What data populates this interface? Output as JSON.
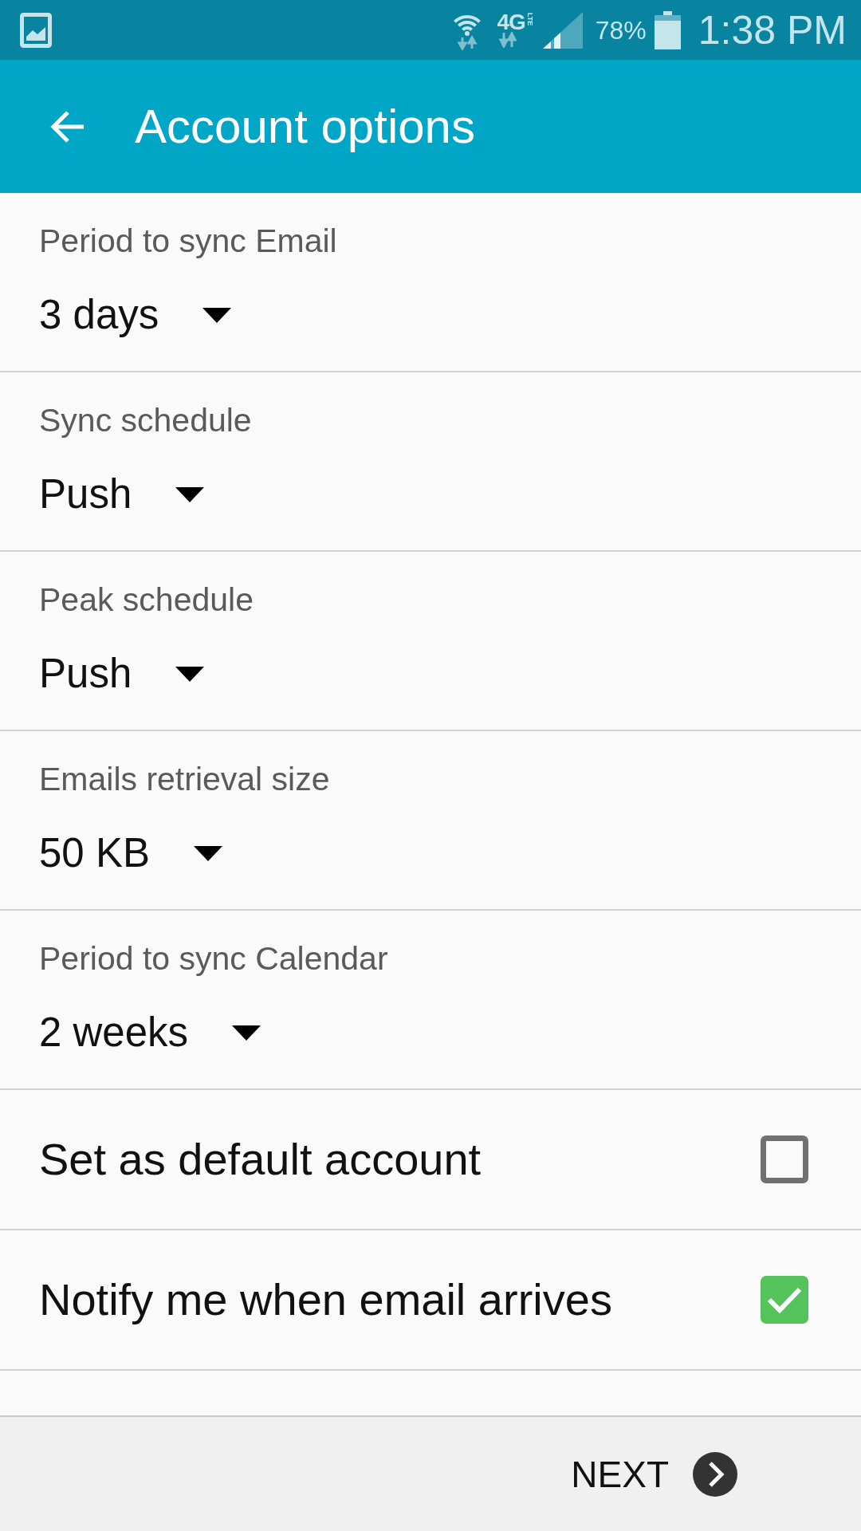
{
  "status_bar": {
    "network": "4G",
    "network_sub": "LTE",
    "battery": "78%",
    "time": "1:38 PM"
  },
  "app_bar": {
    "title": "Account options"
  },
  "settings": [
    {
      "kind": "dropdown",
      "label": "Period to sync Email",
      "value": "3 days"
    },
    {
      "kind": "dropdown",
      "label": "Sync schedule",
      "value": "Push"
    },
    {
      "kind": "dropdown",
      "label": "Peak schedule",
      "value": "Push"
    },
    {
      "kind": "dropdown",
      "label": "Emails retrieval size",
      "value": "50 KB"
    },
    {
      "kind": "dropdown",
      "label": "Period to sync Calendar",
      "value": "2 weeks"
    },
    {
      "kind": "checkbox",
      "label": "Set as default account",
      "checked": false
    },
    {
      "kind": "checkbox",
      "label": "Notify me when email arrives",
      "checked": true
    }
  ],
  "footer": {
    "next_button": "NEXT"
  }
}
